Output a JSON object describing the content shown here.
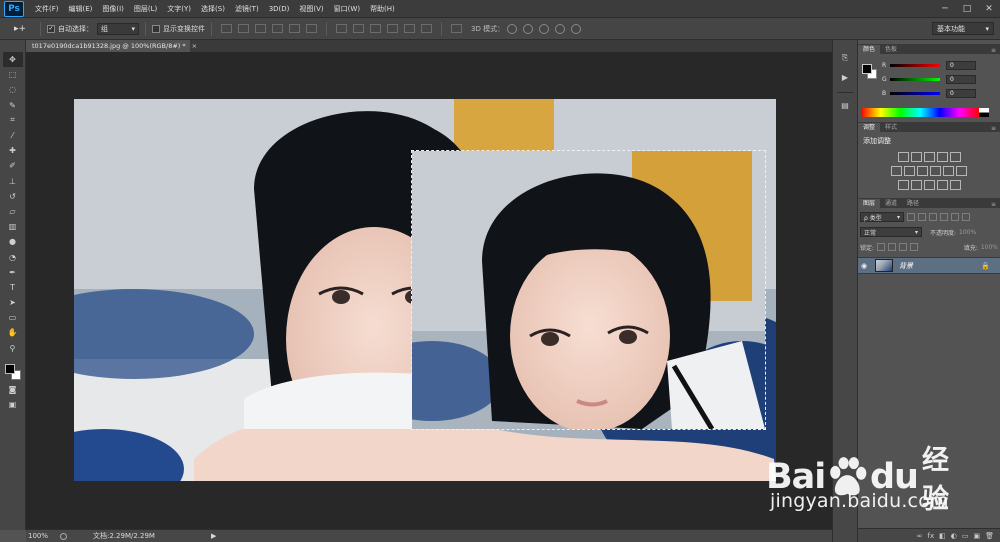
{
  "app": {
    "logo": "Ps"
  },
  "menu": [
    "文件(F)",
    "编辑(E)",
    "图像(I)",
    "图层(L)",
    "文字(Y)",
    "选择(S)",
    "滤镜(T)",
    "3D(D)",
    "视图(V)",
    "窗口(W)",
    "帮助(H)"
  ],
  "window_controls": {
    "minimize": "─",
    "maximize": "□",
    "close": "✕"
  },
  "options": {
    "tool_glyph": "▸+",
    "auto_select_label": "自动选择：",
    "auto_select_checked": true,
    "auto_select_value": "组",
    "show_transform_label": "显示变换控件",
    "show_transform_checked": false,
    "mode_3d_label": "3D 模式：",
    "workspace": "基本功能"
  },
  "document": {
    "tab_title": "t017e0190dca1b91328.jpg @ 100%(RGB/8#) *",
    "close_glyph": "×"
  },
  "status": {
    "zoom": "100%",
    "doc_size": "文档:2.29M/2.29M",
    "arrow": "▶"
  },
  "panels": {
    "color_tabs": [
      "颜色",
      "色板"
    ],
    "color_rows": [
      {
        "label": "R",
        "value": "0",
        "gradient": "linear-gradient(90deg,#000,#f00)"
      },
      {
        "label": "G",
        "value": "0",
        "gradient": "linear-gradient(90deg,#000,#0f0)"
      },
      {
        "label": "B",
        "value": "0",
        "gradient": "linear-gradient(90deg,#000,#00f)"
      }
    ],
    "adjust_tabs": [
      "调整",
      "样式"
    ],
    "adjust_title": "添加调整",
    "layers_tabs": [
      "图层",
      "通道",
      "路径"
    ],
    "layer_kind": "ρ 类型",
    "blend_mode": "正常",
    "opacity_label": "不透明度:",
    "opacity_value": "100%",
    "lock_label": "锁定:",
    "fill_label": "填充:",
    "fill_value": "100%",
    "layer_name": "背景",
    "footer_icons": [
      "∞",
      "fx",
      "◧",
      "◐",
      "▭",
      "▣",
      "🗑"
    ]
  },
  "watermark": {
    "line1_left": "Bai",
    "line1_right": "du",
    "line1_suffix": "经验",
    "url": "jingyan.baidu.com"
  },
  "colors": {
    "selected_layer": "#5d6f82",
    "panel_bg": "#535353",
    "canvas_bg": "#282828"
  }
}
